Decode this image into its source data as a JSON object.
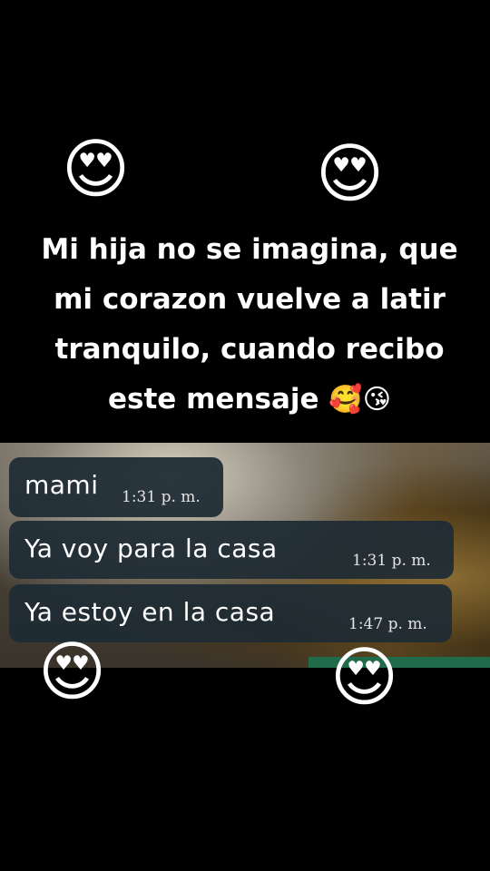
{
  "caption": {
    "text": "Mi hija no se imagina, que mi corazon vuelve a latir tranquilo, cuando recibo este mensaje",
    "emojis": "🥰😘"
  },
  "top_emojis": [
    "😍",
    "😍"
  ],
  "bottom_emojis": [
    "😍",
    "😍"
  ],
  "messages": [
    {
      "text": "mami",
      "time": "1:31 p. m."
    },
    {
      "text": "Ya voy para la casa",
      "time": "1:31 p. m."
    },
    {
      "text": "Ya estoy en la casa",
      "time": "1:47 p. m."
    }
  ],
  "colors": {
    "background": "#000000",
    "bubble": "#1f2c34",
    "accent_strip": "#1f6b4a"
  }
}
